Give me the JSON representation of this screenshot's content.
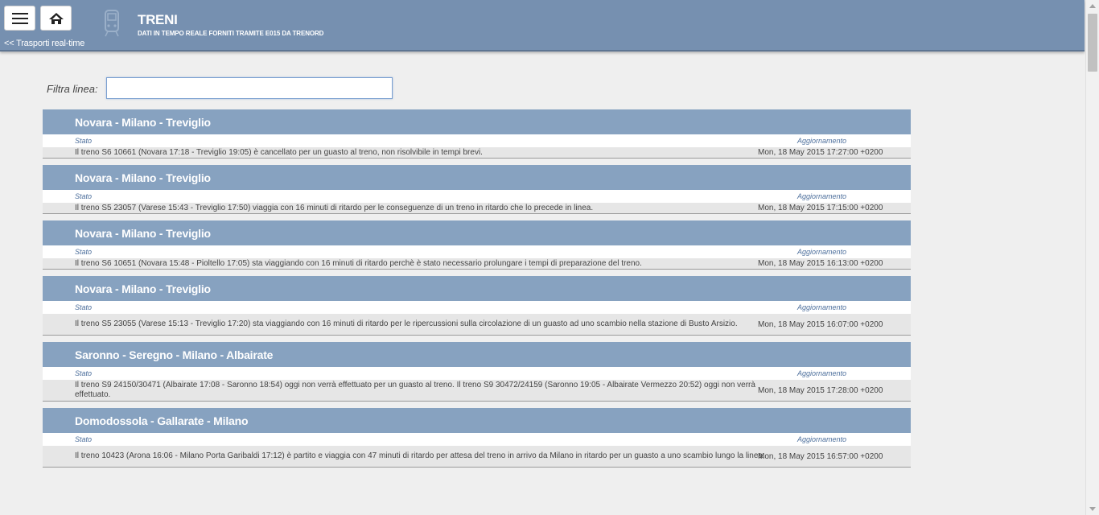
{
  "header": {
    "title": "TRENI",
    "subtitle": "DATI IN TEMPO REALE FORNITI TRAMITE E015 DA TRENORD",
    "back_link": "<< Trasporti real-time",
    "menu_icon": "hamburger-icon",
    "home_icon": "home-icon",
    "train_icon": "train-icon"
  },
  "filter": {
    "label": "Filtra linea:",
    "value": "",
    "placeholder": ""
  },
  "column_labels": {
    "stato": "Stato",
    "aggiornamento": "Aggiornamento"
  },
  "entries": [
    {
      "line": "Novara - Milano - Treviglio",
      "status": "Il treno S6 10661 (Novara 17:18 - Treviglio 19:05) è cancellato per un guasto al treno, non risolvibile in tempi brevi.",
      "updated": "Mon, 18 May 2015 17:27:00 +0200"
    },
    {
      "line": "Novara - Milano - Treviglio",
      "status": "Il treno S5 23057 (Varese 15:43 - Treviglio 17:50) viaggia con 16 minuti di ritardo per le conseguenze di un treno in ritardo che lo precede in linea.",
      "updated": "Mon, 18 May 2015 17:15:00 +0200"
    },
    {
      "line": "Novara - Milano - Treviglio",
      "status": "Il treno S6 10651 (Novara 15:48 - Pioltello 17:05) sta viaggiando con 16 minuti di ritardo perchè è stato necessario prolungare i tempi di preparazione del treno.",
      "updated": "Mon, 18 May 2015 16:13:00 +0200"
    },
    {
      "line": "Novara - Milano - Treviglio",
      "status": "Il treno S5 23055 (Varese 15:13 - Treviglio 17:20) sta viaggiando con 16 minuti di ritardo per le ripercussioni sulla circolazione di un guasto ad uno scambio nella stazione di Busto Arsizio.",
      "updated": "Mon, 18 May 2015 16:07:00 +0200"
    },
    {
      "line": "Saronno - Seregno - Milano - Albairate",
      "status": "Il treno S9 24150/30471 (Albairate 17:08 - Saronno 18:54) oggi non verrà effettuato per un guasto al treno. Il treno S9 30472/24159 (Saronno 19:05 - Albairate Vermezzo 20:52) oggi non verrà effettuato.",
      "updated": "Mon, 18 May 2015 17:28:00 +0200"
    },
    {
      "line": "Domodossola - Gallarate - Milano",
      "status": "Il treno 10423 (Arona 16:06 - Milano Porta Garibaldi 17:12) è partito e viaggia con 47 minuti di ritardo per attesa del treno in arrivo da Milano in ritardo per un guasto a uno scambio lungo la linea.",
      "updated": "Mon, 18 May 2015 16:57:00 +0200"
    }
  ]
}
